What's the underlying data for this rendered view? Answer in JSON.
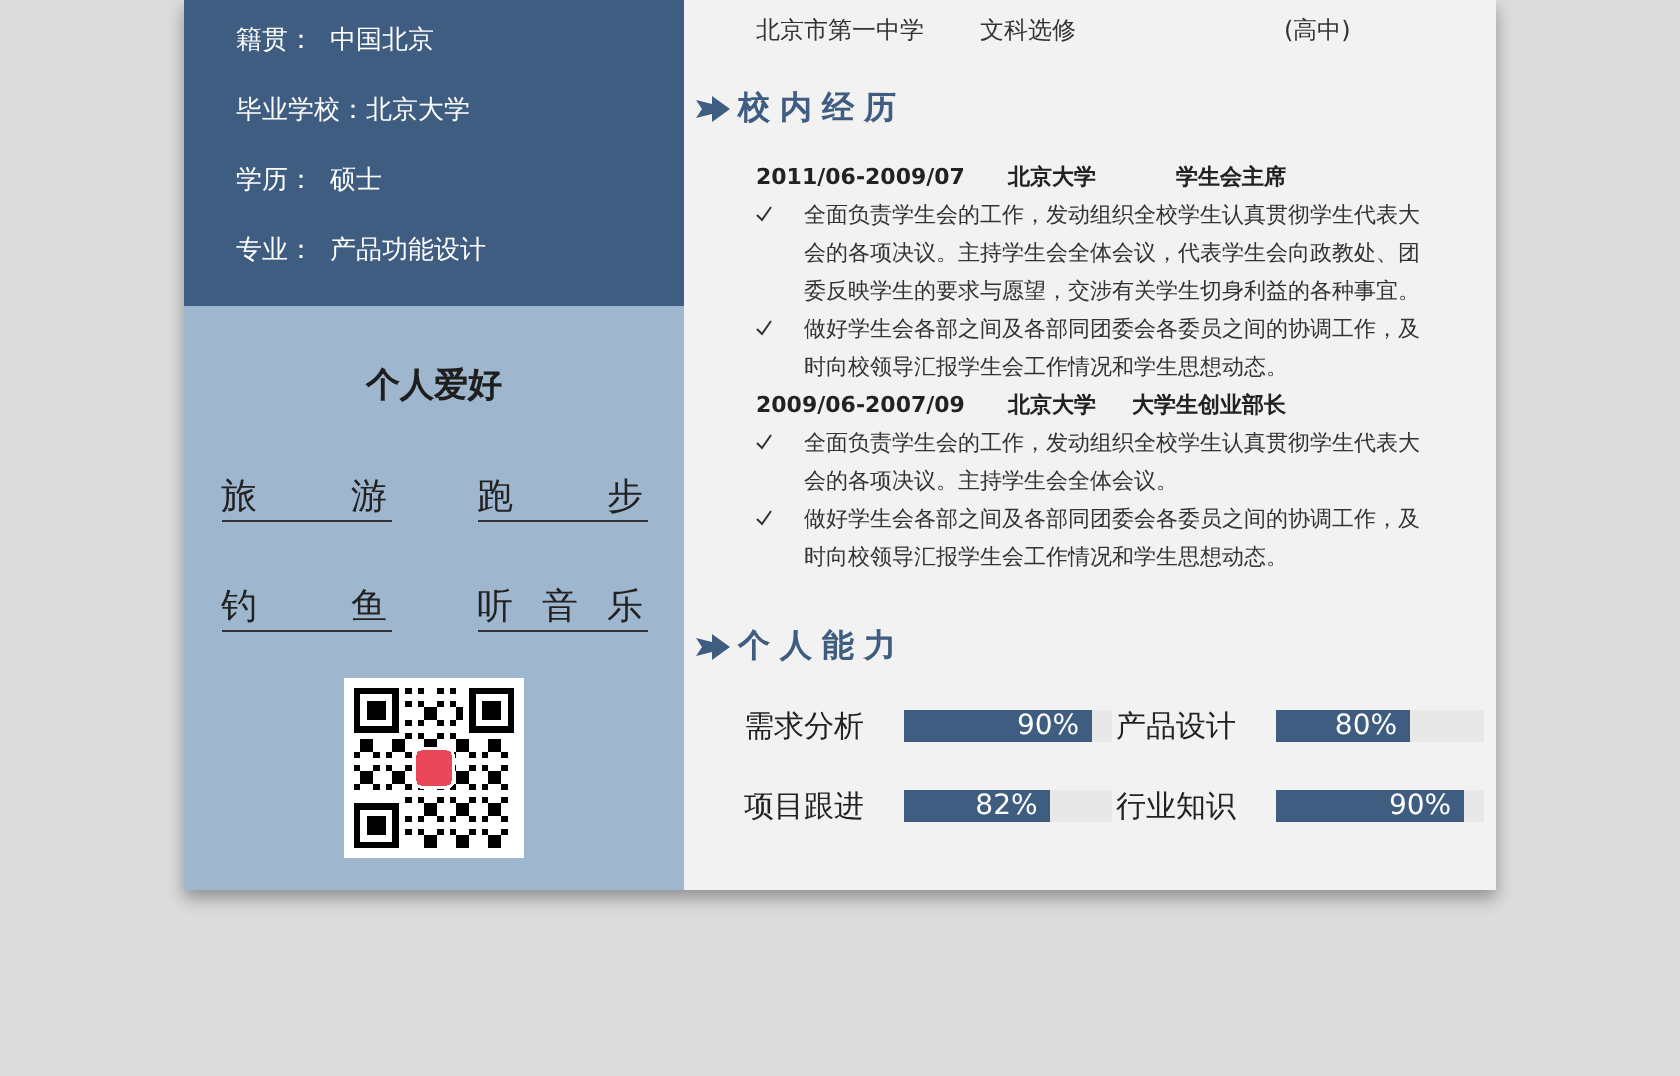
{
  "profile": [
    {
      "label": "籍贯：",
      "value": "中国北京"
    },
    {
      "label": "毕业学校：",
      "value": "北京大学"
    },
    {
      "label": "学历：",
      "value": "硕士"
    },
    {
      "label": "专业：",
      "value": "产品功能设计"
    }
  ],
  "hobbies": {
    "title": "个人爱好",
    "items": [
      "旅游",
      "跑步",
      "钓鱼",
      "听音乐"
    ]
  },
  "education_row": {
    "school": "北京市第一中学",
    "major": "文科选修",
    "level": "(高中)"
  },
  "experience": {
    "title": "校内经历",
    "entries": [
      {
        "period": "2011/06-2009/07",
        "org": "北京大学",
        "role": "学生会主席",
        "bullets": [
          "全面负责学生会的工作，发动组织全校学生认真贯彻学生代表大会的各项决议。主持学生会全体会议，代表学生会向政教处、团委反映学生的要求与愿望，交涉有关学生切身利益的各种事宜。",
          "做好学生会各部之间及各部同团委会各委员之间的协调工作，及时向校领导汇报学生会工作情况和学生思想动态。"
        ]
      },
      {
        "period": "2009/06-2007/09",
        "org": "北京大学",
        "role": "大学生创业部长",
        "bullets": [
          "全面负责学生会的工作，发动组织全校学生认真贯彻学生代表大会的各项决议。主持学生会全体会议。",
          "做好学生会各部之间及各部同团委会各委员之间的协调工作，及时向校领导汇报学生会工作情况和学生思想动态。"
        ]
      }
    ]
  },
  "skills": {
    "title": "个人能力",
    "items": [
      {
        "name": "需求分析",
        "level": 0.9,
        "reading": "90%"
      },
      {
        "name": "产品设计",
        "level": 0.64,
        "reading": "80%"
      },
      {
        "name": "项目跟进",
        "level": 0.7,
        "reading": "82%"
      },
      {
        "name": "行业知识",
        "level": 0.9,
        "reading": "90%"
      }
    ]
  }
}
